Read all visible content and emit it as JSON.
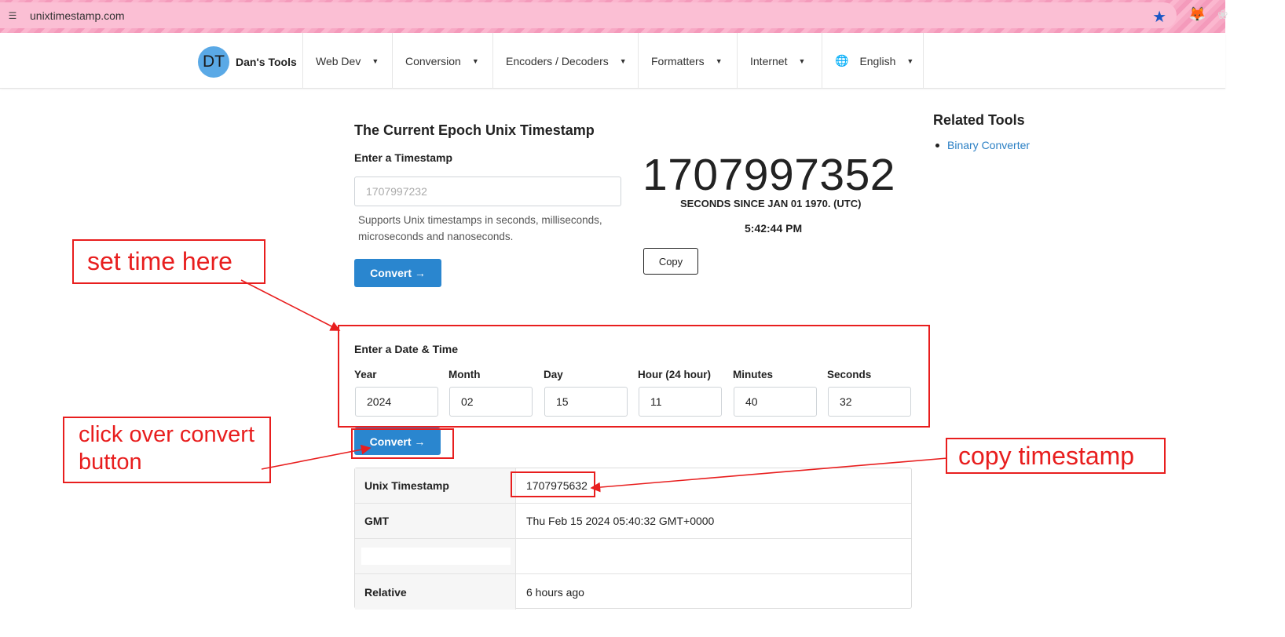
{
  "browser": {
    "url": "unixtimestamp.com"
  },
  "nav": {
    "brand_logo": "DT",
    "brand_name": "Dan's Tools",
    "items": [
      {
        "label": "Web Dev"
      },
      {
        "label": "Conversion"
      },
      {
        "label": "Encoders / Decoders"
      },
      {
        "label": "Formatters"
      },
      {
        "label": "Internet"
      },
      {
        "label": "English"
      }
    ]
  },
  "main": {
    "title": "The Current Epoch Unix Timestamp",
    "enter_timestamp_label": "Enter a Timestamp",
    "timestamp_placeholder": "1707997232",
    "help_text": "Supports Unix timestamps in seconds, milliseconds, microseconds and nanoseconds.",
    "convert_label": "Convert →",
    "current_timestamp": "1707997352",
    "since_text": "SECONDS SINCE JAN 01 1970. (UTC)",
    "clock": "5:42:44 PM",
    "copy_label": "Copy"
  },
  "related": {
    "title": "Related Tools",
    "links": [
      "Binary Converter"
    ]
  },
  "datetime": {
    "label": "Enter a Date & Time",
    "fields": [
      {
        "label": "Year",
        "value": "2024"
      },
      {
        "label": "Month",
        "value": "02"
      },
      {
        "label": "Day",
        "value": "15"
      },
      {
        "label": "Hour (24 hour)",
        "value": "11"
      },
      {
        "label": "Minutes",
        "value": "40"
      },
      {
        "label": "Seconds",
        "value": "32"
      }
    ],
    "convert_label": "Convert →"
  },
  "result": {
    "rows": [
      {
        "key": "Unix Timestamp",
        "value": "1707975632"
      },
      {
        "key": "GMT",
        "value": "Thu Feb 15 2024 05:40:32 GMT+0000"
      },
      {
        "key": "",
        "value": ""
      },
      {
        "key": "Relative",
        "value": "6 hours ago"
      }
    ]
  },
  "annotations": {
    "set_time": "set time here",
    "click_convert": "click over convert button",
    "copy_timestamp": "copy timestamp",
    "color": "#e81e1e"
  }
}
